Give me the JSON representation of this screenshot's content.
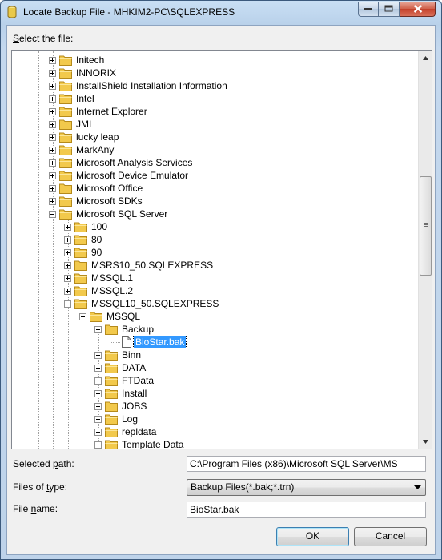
{
  "window": {
    "title": "Locate Backup File - MHKIM2-PC\\SQLEXPRESS",
    "controls": [
      "minimize-icon",
      "maximize-icon",
      "close-icon"
    ]
  },
  "select_label_prefix": "S",
  "select_label_rest": "elect the file:",
  "tree": {
    "nodes": [
      {
        "label": "Initech",
        "depth": 0,
        "expand": "plus"
      },
      {
        "label": "INNORIX",
        "depth": 0,
        "expand": "plus"
      },
      {
        "label": "InstallShield Installation Information",
        "depth": 0,
        "expand": "plus"
      },
      {
        "label": "Intel",
        "depth": 0,
        "expand": "plus"
      },
      {
        "label": "Internet Explorer",
        "depth": 0,
        "expand": "plus"
      },
      {
        "label": "JMI",
        "depth": 0,
        "expand": "plus"
      },
      {
        "label": "lucky leap",
        "depth": 0,
        "expand": "plus"
      },
      {
        "label": "MarkAny",
        "depth": 0,
        "expand": "plus"
      },
      {
        "label": "Microsoft Analysis Services",
        "depth": 0,
        "expand": "plus"
      },
      {
        "label": "Microsoft Device Emulator",
        "depth": 0,
        "expand": "plus"
      },
      {
        "label": "Microsoft Office",
        "depth": 0,
        "expand": "plus"
      },
      {
        "label": "Microsoft SDKs",
        "depth": 0,
        "expand": "plus"
      },
      {
        "label": "Microsoft SQL Server",
        "depth": 0,
        "expand": "minus"
      },
      {
        "label": "100",
        "depth": 1,
        "expand": "plus"
      },
      {
        "label": "80",
        "depth": 1,
        "expand": "plus"
      },
      {
        "label": "90",
        "depth": 1,
        "expand": "plus"
      },
      {
        "label": "MSRS10_50.SQLEXPRESS",
        "depth": 1,
        "expand": "plus"
      },
      {
        "label": "MSSQL.1",
        "depth": 1,
        "expand": "plus"
      },
      {
        "label": "MSSQL.2",
        "depth": 1,
        "expand": "plus"
      },
      {
        "label": "MSSQL10_50.SQLEXPRESS",
        "depth": 1,
        "expand": "minus"
      },
      {
        "label": "MSSQL",
        "depth": 2,
        "expand": "minus"
      },
      {
        "label": "Backup",
        "depth": 3,
        "expand": "minus"
      },
      {
        "label": "BioStar.bak",
        "depth": 4,
        "expand": "none",
        "file": true,
        "selected": true
      },
      {
        "label": "Binn",
        "depth": 3,
        "expand": "plus"
      },
      {
        "label": "DATA",
        "depth": 3,
        "expand": "plus"
      },
      {
        "label": "FTData",
        "depth": 3,
        "expand": "plus"
      },
      {
        "label": "Install",
        "depth": 3,
        "expand": "plus"
      },
      {
        "label": "JOBS",
        "depth": 3,
        "expand": "plus"
      },
      {
        "label": "Log",
        "depth": 3,
        "expand": "plus"
      },
      {
        "label": "repldata",
        "depth": 3,
        "expand": "plus"
      },
      {
        "label": "Template Data",
        "depth": 3,
        "expand": "plus"
      }
    ]
  },
  "selected_path": {
    "label_pre": "Selected ",
    "label_ul": "p",
    "label_post": "ath:",
    "value": "C:\\Program Files (x86)\\Microsoft SQL Server\\MS"
  },
  "files_of_type": {
    "label_pre": "Files of ",
    "label_ul": "t",
    "label_post": "ype:",
    "value": "Backup Files(*.bak;*.trn)"
  },
  "file_name": {
    "label_pre": "File ",
    "label_ul": "n",
    "label_post": "ame:",
    "value": "BioStar.bak"
  },
  "buttons": {
    "ok": "OK",
    "cancel": "Cancel"
  },
  "colors": {
    "selection": "#3399ff",
    "folder": "#f2c94c"
  }
}
